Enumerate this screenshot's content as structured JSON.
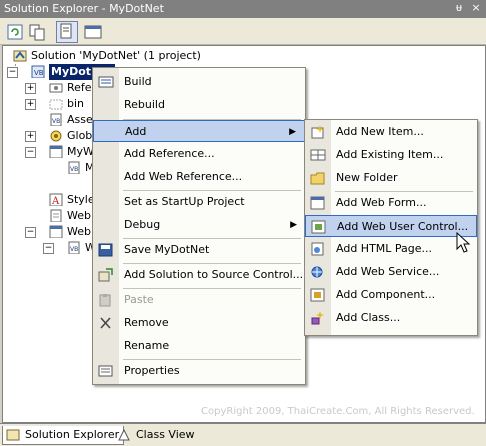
{
  "window": {
    "title": "Solution Explorer - MyDotNet",
    "pin_glyph": "ᵾ",
    "close_glyph": "×"
  },
  "tree": {
    "solution": "Solution 'MyDotNet' (1 project)",
    "project": "MyDotNet",
    "nodes": [
      "Refer",
      "bin",
      "Asser",
      "Globa",
      "MyWe",
      "M",
      "Styles",
      "Web.",
      "WebF",
      "W"
    ]
  },
  "context_menu": {
    "items": [
      {
        "label": "Build",
        "icon": "build-icon"
      },
      {
        "label": "Rebuild",
        "icon": ""
      },
      {
        "label": "Add",
        "icon": "",
        "highlighted": true,
        "submenu": true
      },
      {
        "label": "Add Reference...",
        "icon": ""
      },
      {
        "label": "Add Web Reference...",
        "icon": ""
      },
      {
        "label": "Set as StartUp Project",
        "icon": ""
      },
      {
        "label": "Debug",
        "icon": "",
        "submenu": true
      },
      {
        "label": "Save MyDotNet",
        "icon": "save-icon"
      },
      {
        "label": "Add Solution to Source Control...",
        "icon": "source-control-icon"
      },
      {
        "label": "Paste",
        "icon": "paste-icon",
        "disabled": true
      },
      {
        "label": "Remove",
        "icon": "remove-icon"
      },
      {
        "label": "Rename",
        "icon": ""
      },
      {
        "label": "Properties",
        "icon": "properties-icon"
      }
    ]
  },
  "submenu": {
    "items": [
      {
        "label": "Add New Item...",
        "icon": "new-item-icon"
      },
      {
        "label": "Add Existing Item...",
        "icon": "existing-item-icon"
      },
      {
        "label": "New Folder",
        "icon": "folder-icon"
      },
      {
        "label": "Add Web Form...",
        "icon": "web-form-icon"
      },
      {
        "label": "Add Web User Control...",
        "icon": "user-control-icon",
        "highlighted": true
      },
      {
        "label": "Add HTML Page...",
        "icon": "html-page-icon"
      },
      {
        "label": "Add Web Service...",
        "icon": "web-service-icon"
      },
      {
        "label": "Add Component...",
        "icon": "component-icon"
      },
      {
        "label": "Add Class...",
        "icon": "class-icon"
      }
    ]
  },
  "watermark": "CopyRight 2009, ThaiCreate.Com, All Rights Reserved.",
  "tabs": {
    "solution_explorer": "Solution Explorer",
    "class_view": "Class View"
  },
  "colors": {
    "selection": "#0a246a",
    "highlight": "#c1d2ee",
    "highlight_border": "#316ac5"
  }
}
